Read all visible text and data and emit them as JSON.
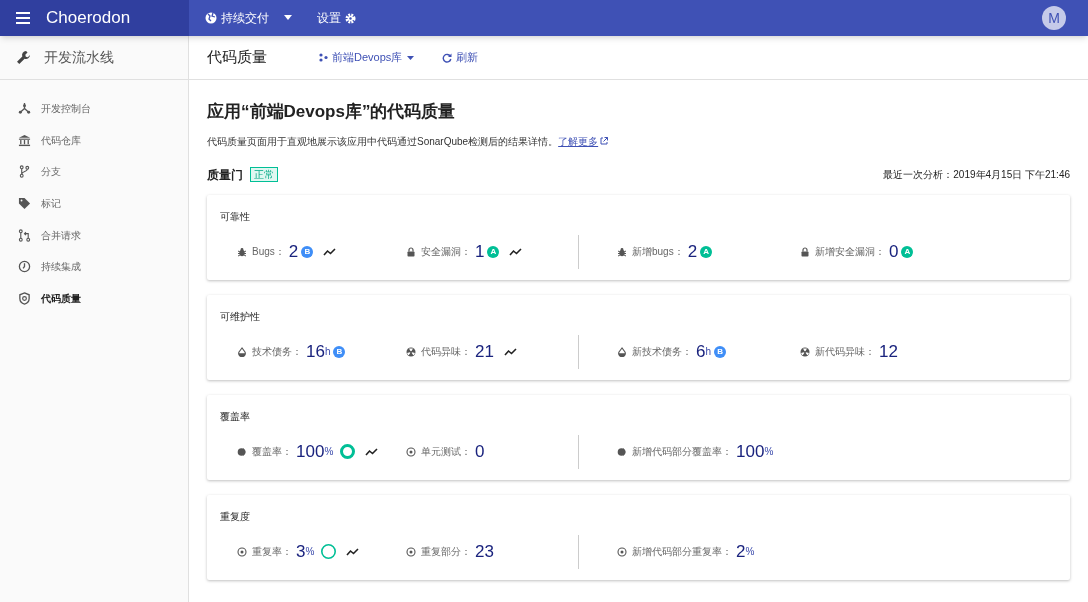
{
  "topbar": {
    "brand": "Choerodon",
    "project": "持续交付",
    "settings": "设置",
    "avatar": "M"
  },
  "sidebar": {
    "title": "开发流水线",
    "items": [
      {
        "kind": "network",
        "label": "开发控制台",
        "selected": false
      },
      {
        "kind": "bank",
        "label": "代码仓库",
        "selected": false
      },
      {
        "kind": "branch",
        "label": "分支",
        "selected": false
      },
      {
        "kind": "tag",
        "label": "标记",
        "selected": false
      },
      {
        "kind": "merge",
        "label": "合并请求",
        "selected": false
      },
      {
        "kind": "ci",
        "label": "持续集成",
        "selected": false
      },
      {
        "kind": "shield",
        "label": "代码质量",
        "selected": true
      }
    ]
  },
  "header": {
    "title": "代码质量",
    "app_select": "前端Devops库",
    "refresh": "刷新"
  },
  "page": {
    "heading": "应用“前端Devops库”的代码质量",
    "description": "代码质量页面用于直观地展示该应用中代码通过SonarQube检测后的结果详情。",
    "learn_more": "了解更多",
    "gate_label": "质量门",
    "gate_status": "正常",
    "last_analysis": "最近一次分析：2019年4月15日 下午21:46"
  },
  "cards": [
    {
      "title": "可靠性",
      "left": [
        {
          "kind": "bug",
          "label": "Bugs：",
          "value": "2",
          "rating": "B",
          "color": "#3f8ef7",
          "trend": true
        },
        {
          "kind": "lock",
          "label": "安全漏洞：",
          "value": "1",
          "rating": "A",
          "color": "#00bf96",
          "trend": true
        }
      ],
      "right": [
        {
          "kind": "bug",
          "label": "新增bugs：",
          "value": "2",
          "rating": "A",
          "color": "#00bf96",
          "trend": false
        },
        {
          "kind": "lock",
          "label": "新增安全漏洞：",
          "value": "0",
          "rating": "A",
          "color": "#00bf96",
          "trend": false
        }
      ]
    },
    {
      "title": "可维护性",
      "left": [
        {
          "kind": "drop",
          "label": "技术债务：",
          "value": "16",
          "unit": "h",
          "rating": "B",
          "color": "#3f8ef7",
          "trend": false
        },
        {
          "kind": "radiation",
          "label": "代码异味：",
          "value": "21",
          "trend": true
        }
      ],
      "right": [
        {
          "kind": "drop",
          "label": "新技术债务：",
          "value": "6",
          "unit": "h",
          "rating": "B",
          "color": "#3f8ef7",
          "trend": false
        },
        {
          "kind": "radiation",
          "label": "新代码异味：",
          "value": "12",
          "trend": false
        }
      ]
    },
    {
      "title": "覆盖率",
      "left": [
        {
          "kind": "toggle",
          "label": "覆盖率：",
          "value": "100",
          "unit": "%",
          "ring": true,
          "trend": true
        },
        {
          "kind": "target",
          "label": "单元测试：",
          "value": "0",
          "trend": false
        }
      ],
      "right": [
        {
          "kind": "toggle",
          "label": "新增代码部分覆盖率：",
          "value": "100",
          "unit": "%",
          "trend": false
        }
      ]
    },
    {
      "title": "重复度",
      "left": [
        {
          "kind": "target",
          "label": "重复率：",
          "value": "3",
          "unit": "%",
          "ring": true,
          "trend": true
        },
        {
          "kind": "target",
          "label": "重复部分：",
          "value": "23",
          "trend": false
        }
      ],
      "right": [
        {
          "kind": "target",
          "label": "新增代码部分重复率：",
          "value": "2",
          "unit": "%",
          "trend": false
        }
      ]
    }
  ]
}
